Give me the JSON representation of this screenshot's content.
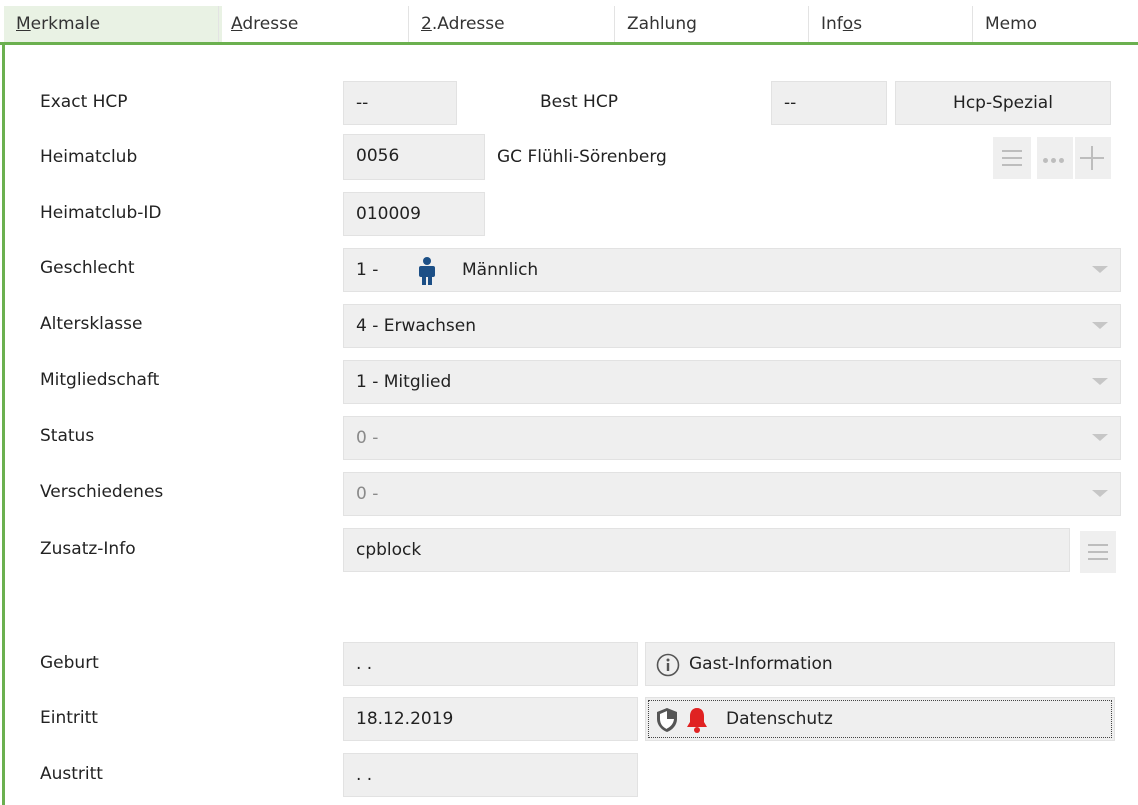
{
  "tabs": [
    {
      "pre": "",
      "mn": "M",
      "post": "erkmale"
    },
    {
      "pre": "",
      "mn": "A",
      "post": "dresse"
    },
    {
      "pre": "",
      "mn": "2",
      "post": ".Adresse"
    },
    {
      "pre": "Zahlung",
      "mn": "",
      "post": ""
    },
    {
      "pre": "Inf",
      "mn": "o",
      "post": "s"
    },
    {
      "pre": "Memo",
      "mn": "",
      "post": ""
    }
  ],
  "fields": {
    "exact_hcp": {
      "label": "Exact HCP",
      "value": "--"
    },
    "best_hcp": {
      "label": "Best HCP",
      "value": "--"
    },
    "hcp_spezial": "Hcp-Spezial",
    "heimatclub": {
      "label": "Heimatclub",
      "code": "0056",
      "name": "GC Flühli-Sörenberg"
    },
    "heimatclub_id": {
      "label": "Heimatclub-ID",
      "value": "010009"
    },
    "geschlecht": {
      "label": "Geschlecht",
      "code": "1 -",
      "text": "Männlich"
    },
    "altersklasse": {
      "label": "Altersklasse",
      "value": "4 - Erwachsen"
    },
    "mitgliedschaft": {
      "label": "Mitgliedschaft",
      "value": "1 - Mitglied"
    },
    "status": {
      "label": "Status",
      "value": "0 -"
    },
    "verschiedenes": {
      "label": "Verschiedenes",
      "value": "0 -"
    },
    "zusatz_info": {
      "label": "Zusatz-Info",
      "value": "cpblock"
    },
    "geburt": {
      "label": "Geburt",
      "value": ". ."
    },
    "gast_information": "Gast-Information",
    "eintritt": {
      "label": "Eintritt",
      "value": "18.12.2019"
    },
    "datenschutz": "Datenschutz",
    "austritt": {
      "label": "Austritt",
      "value": ". ."
    }
  }
}
